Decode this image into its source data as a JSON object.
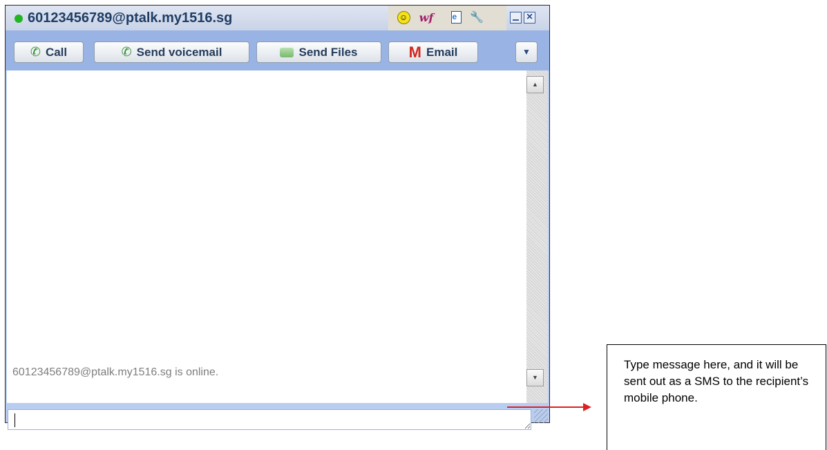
{
  "window": {
    "title": "60123456789@ptalk.my1516.sg",
    "status_color": "#22b522",
    "tools": [
      "smiley-icon",
      "wf-logo",
      "doc-icon",
      "wrench-icon"
    ],
    "wf_text": "wf",
    "smiley_text": "☺",
    "wrench_text": "🔧"
  },
  "toolbar": {
    "call_label": "Call",
    "voicemail_label": "Send voicemail",
    "files_label": "Send Files",
    "email_label": "Email",
    "more_label": "▼"
  },
  "messages": {
    "status_text": "60123456789@ptalk.my1516.sg is online."
  },
  "input": {
    "value": ""
  },
  "annotation": {
    "text": "Type message here, and it will be sent out as a SMS to the recipient’s mobile phone."
  }
}
